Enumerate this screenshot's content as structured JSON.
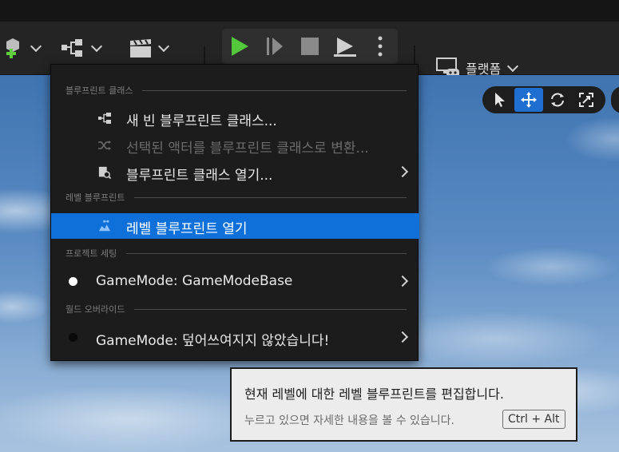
{
  "toolbar": {
    "platform_label": "플랫폼"
  },
  "menu": {
    "sections": {
      "blueprint_class": "블루프린트 클래스",
      "level_blueprint": "레벨 블루프린트",
      "project_settings": "프로젝트 세팅",
      "world_override": "월드 오버라이드"
    },
    "items": {
      "new_blueprint": "새 빈 블루프린트 클래스...",
      "convert_actor": "선택된 액터를 블루프린트 클래스로 변환...",
      "open_blueprint_class": "블루프린트 클래스 열기...",
      "open_level_blueprint": "레벨 블루프린트 열기",
      "gamemode_project": "GameMode: GameModeBase",
      "gamemode_world": "GameMode: 덮어쓰여지지 않았습니다!"
    }
  },
  "tooltip": {
    "main": "현재 레벨에 대한 레벨 블루프린트를 편집합니다.",
    "sub": "누르고 있으면 자세한 내용을 볼 수 있습니다.",
    "shortcut": "Ctrl + Alt"
  },
  "colors": {
    "selection": "#0e70d8",
    "play_green": "#52c83a",
    "active_tool": "#1f6fd1"
  },
  "icons": {
    "add_actor": "cube-plus-icon",
    "blueprint": "blueprint-nodes-icon",
    "cinematics": "clapperboard-icon",
    "play": "play-icon",
    "step": "step-forward-icon",
    "stop": "stop-icon",
    "eject": "eject-icon",
    "platform": "platform-monitor-icon"
  }
}
